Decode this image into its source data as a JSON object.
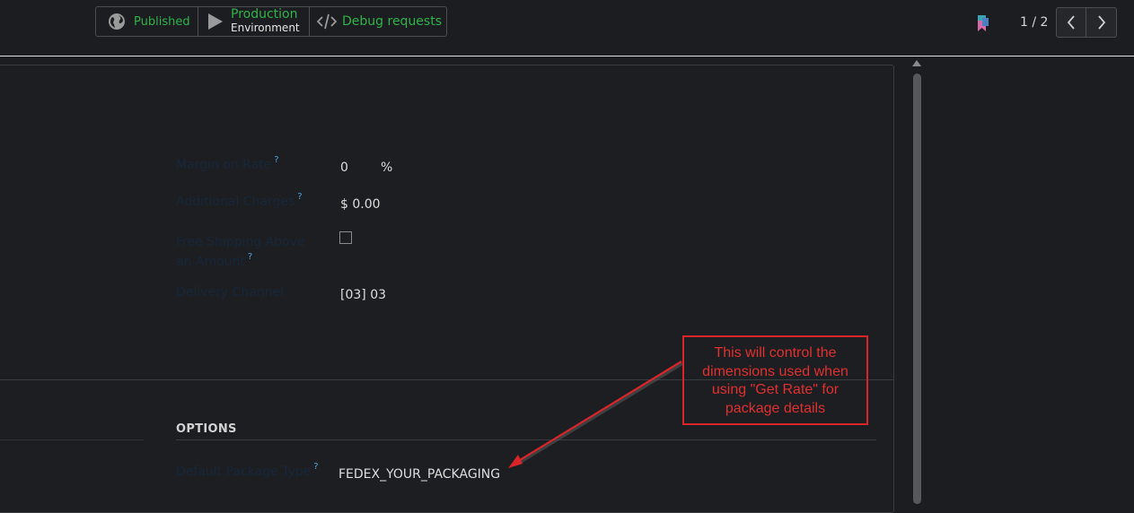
{
  "topbar": {
    "published_label": "Published",
    "production_label": "Production",
    "environment_label": "Environment",
    "debug_label": "Debug requests",
    "pager_text": "1 / 2"
  },
  "fields": [
    {
      "label": "Margin on Rate",
      "value": "0",
      "suffix": "%"
    },
    {
      "label": "Additional Charges",
      "value": "$ 0.00"
    },
    {
      "label": "Free Shipping Above an Amount",
      "value": ""
    },
    {
      "label": "Delivery Channel",
      "value": "[03] 03"
    }
  ],
  "options": {
    "header": "OPTIONS",
    "package_type_label": "Default Package Type",
    "package_type_value": "FEDEX_YOUR_PACKAGING"
  },
  "callout": {
    "text": "This will control the dimensions used when using \"Get Rate\" for package details"
  },
  "colors": {
    "accent_green": "#2fb34a",
    "callout_red": "#d9252a"
  }
}
